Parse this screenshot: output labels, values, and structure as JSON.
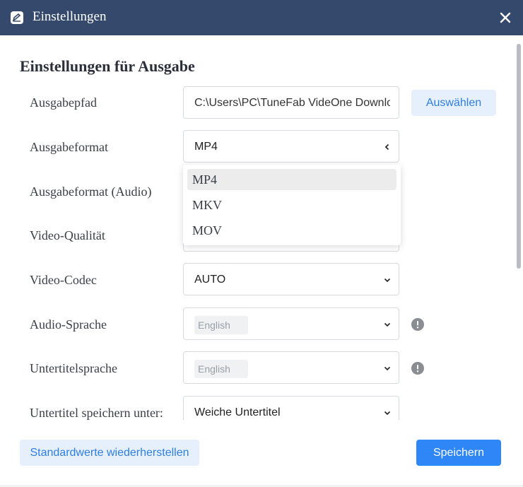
{
  "window": {
    "title": "Einstellungen"
  },
  "section": {
    "title": "Einstellungen für Ausgabe"
  },
  "fields": {
    "output_path": {
      "label": "Ausgabepfad",
      "value": "C:\\Users\\PC\\TuneFab VideOne Downloader"
    },
    "output_format": {
      "label": "Ausgabeformat",
      "value": "MP4"
    },
    "output_format_audio": {
      "label": "Ausgabeformat (Audio)"
    },
    "video_quality": {
      "label": "Video-Qualität"
    },
    "video_codec": {
      "label": "Video-Codec",
      "value": "AUTO"
    },
    "audio_language": {
      "label": "Audio-Sprache",
      "value": "English"
    },
    "subtitle_language": {
      "label": "Untertitelsprache",
      "value": "English"
    },
    "subtitle_save_as": {
      "label": "Untertitel speichern unter:",
      "value": "Weiche Untertitel"
    }
  },
  "dropdown": {
    "options": [
      "MP4",
      "MKV",
      "MOV"
    ],
    "selected": "MP4"
  },
  "buttons": {
    "browse": "Auswählen",
    "reset": "Standardwerte wiederherstellen",
    "save": "Speichern"
  },
  "icons": {
    "app_logo": "app-logo-icon",
    "close": "close-icon",
    "info": "info-icon",
    "chevron": "chevron-down-icon"
  },
  "colors": {
    "titlebar": "#34496c",
    "primary": "#2f86f6",
    "accent_text": "#2f7ee0"
  }
}
